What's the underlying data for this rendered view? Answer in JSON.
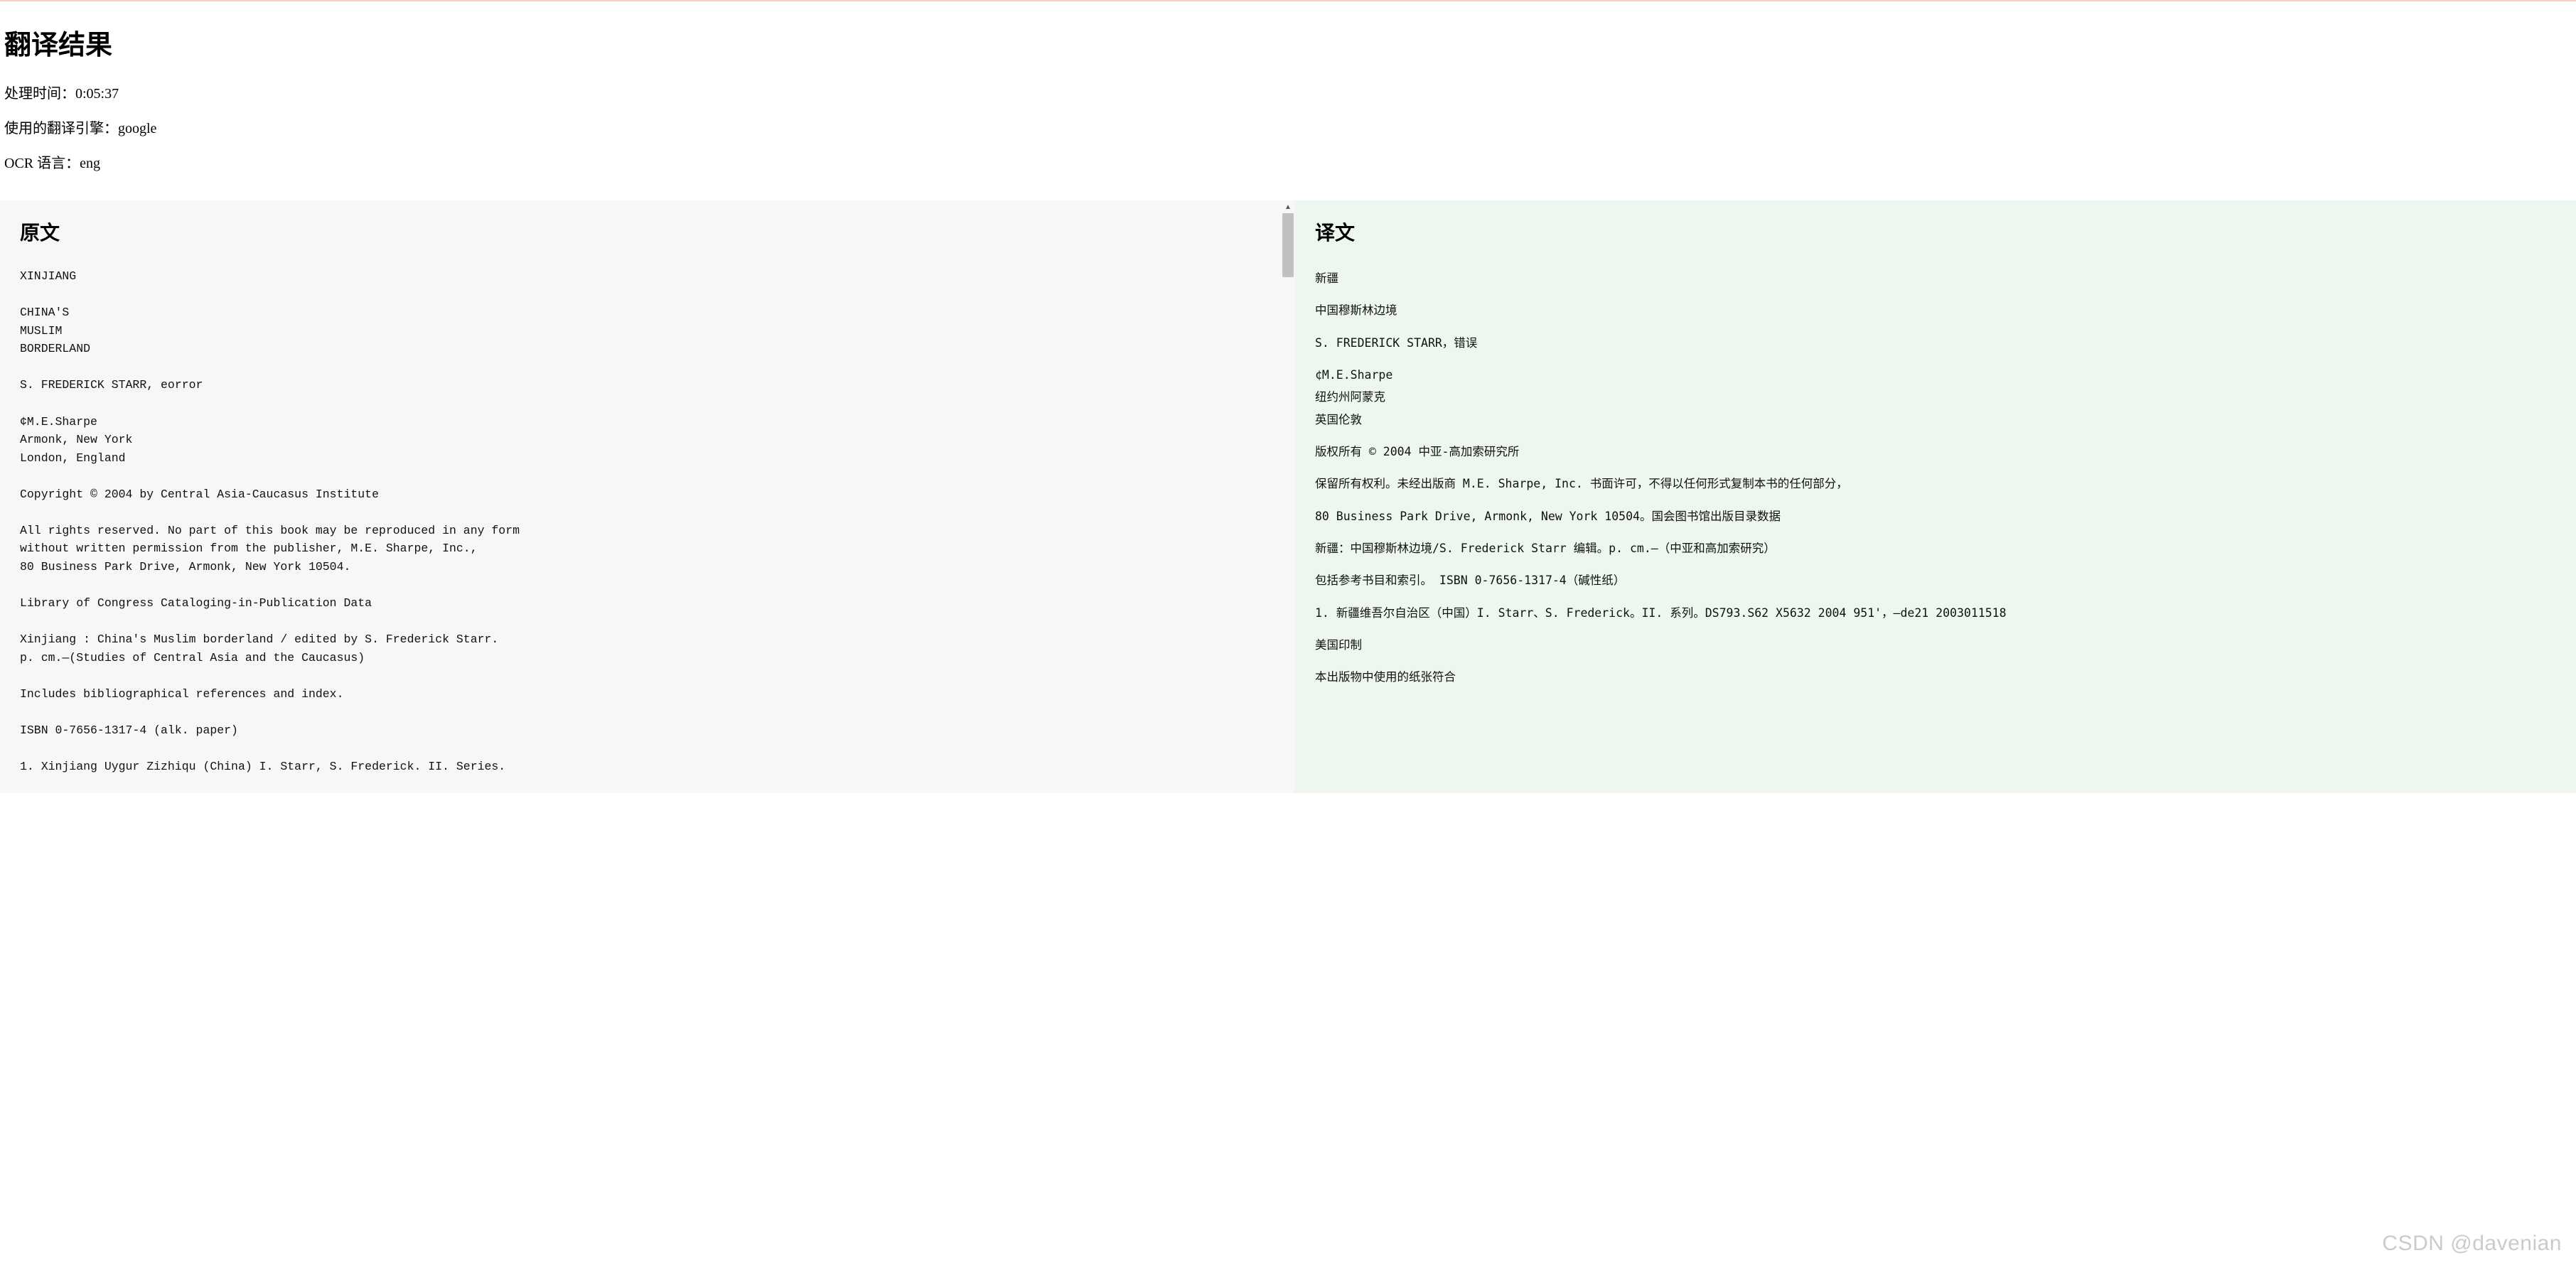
{
  "header": {
    "title": "翻译结果",
    "processing_time_label": "处理时间：",
    "processing_time_value": "0:05:37",
    "engine_label": "使用的翻译引擎：",
    "engine_value": "google",
    "ocr_label": "OCR 语言：",
    "ocr_value": "eng"
  },
  "source_panel": {
    "title": "原文",
    "text": "XINJIANG\n\nCHINA'S\nMUSLIM\nBORDERLAND\n\nS. FREDERICK STARR, eorror\n\n¢M.E.Sharpe\nArmonk, New York\nLondon, England\n\nCopyright © 2004 by Central Asia-Caucasus Institute\n\nAll rights reserved. No part of this book may be reproduced in any form\nwithout written permission from the publisher, M.E. Sharpe, Inc.,\n80 Business Park Drive, Armonk, New York 10504.\n\nLibrary of Congress Cataloging-in-Publication Data\n\nXinjiang : China's Muslim borderland / edited by S. Frederick Starr.\np. cm.—(Studies of Central Asia and the Caucasus)\n\nIncludes bibliographical references and index.\n\nISBN 0-7656-1317-4 (alk. paper)\n\n1. Xinjiang Uygur Zizhiqu (China) I. Starr, S. Frederick. II. Series."
  },
  "target_panel": {
    "title": "译文",
    "paragraphs": [
      "新疆",
      "中国穆斯林边境",
      "S. FREDERICK STARR，错误",
      "¢M.E.Sharpe\n纽约州阿蒙克\n英国伦敦",
      "版权所有 © 2004 中亚-高加索研究所",
      "保留所有权利。未经出版商 M.E. Sharpe, Inc. 书面许可，不得以任何形式复制本书的任何部分，",
      "80 Business Park Drive, Armonk, New York 10504。国会图书馆出版目录数据",
      "新疆：中国穆斯林边境/S. Frederick Starr 编辑。p. cm.—（中亚和高加索研究）",
      "包括参考书目和索引。 ISBN 0-7656-1317-4（碱性纸）",
      "1. 新疆维吾尔自治区（中国）I. Starr、S. Frederick。II. 系列。DS793.S62 X5632 2004 951'，—de21 2003011518",
      "美国印制",
      "本出版物中使用的纸张符合"
    ]
  },
  "watermark": "CSDN @davenian"
}
